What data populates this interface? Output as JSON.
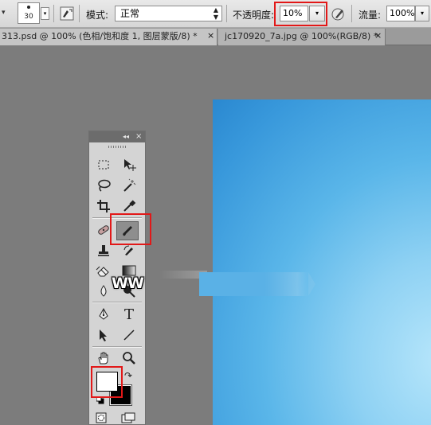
{
  "options_bar": {
    "brush_size": "30",
    "mode_label": "模式:",
    "mode_value": "正常",
    "opacity_label": "不透明度:",
    "opacity_value": "10%",
    "flow_label": "流量:",
    "flow_value": "100%"
  },
  "tabs": [
    {
      "label": "313.psd @ 100% (色相/饱和度 1, 图层蒙版/8) *",
      "close": "×"
    },
    {
      "label": "jc170920_7a.jpg @ 100%(RGB/8) *",
      "close": "×"
    }
  ],
  "toolbox": {
    "header_collapse": "◂◂",
    "header_close": "×",
    "tools": [
      {
        "name": "rectangular-marquee-tool"
      },
      {
        "name": "move-tool"
      },
      {
        "name": "lasso-tool"
      },
      {
        "name": "magic-wand-tool"
      },
      {
        "name": "crop-tool"
      },
      {
        "name": "eyedropper-tool"
      },
      {
        "name": "spot-healing-brush-tool"
      },
      {
        "name": "brush-tool",
        "active": true
      },
      {
        "name": "clone-stamp-tool"
      },
      {
        "name": "history-brush-tool"
      },
      {
        "name": "eraser-tool"
      },
      {
        "name": "gradient-tool"
      },
      {
        "name": "blur-tool"
      },
      {
        "name": "dodge-tool"
      },
      {
        "name": "pen-tool"
      },
      {
        "name": "type-tool",
        "glyph": "T"
      },
      {
        "name": "path-selection-tool"
      },
      {
        "name": "line-tool"
      },
      {
        "name": "hand-tool"
      },
      {
        "name": "zoom-tool"
      }
    ],
    "foreground_color": "#ffffff",
    "background_color": "#000000"
  },
  "watermark": "WW",
  "colors": {
    "highlight": "#e21818",
    "canvas_blue_dark": "#2a88d0",
    "canvas_blue_light": "#b7e6fb"
  }
}
